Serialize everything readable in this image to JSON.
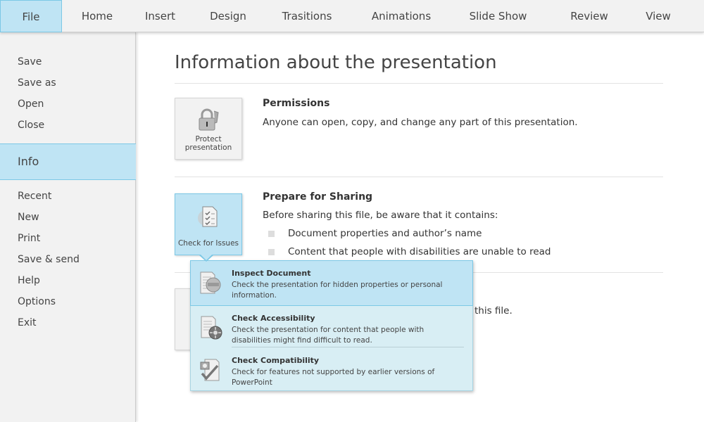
{
  "tabs": [
    "File",
    "Home",
    "Insert",
    "Design",
    "Trasitions",
    "Animations",
    "Slide Show",
    "Review",
    "View"
  ],
  "sidebar": {
    "items": [
      "Save",
      "Save as",
      "Open",
      "Close",
      "Info",
      "Recent",
      "New",
      "Print",
      "Save & send",
      "Help",
      "Options",
      "Exit"
    ],
    "active": "Info"
  },
  "main": {
    "title": "Information about the presentation",
    "permissions": {
      "button": "Protect presentation",
      "title": "Permissions",
      "desc": "Anyone can open, copy, and change any part of this presentation."
    },
    "sharing": {
      "button": "Check for Issues",
      "title": "Prepare for Sharing",
      "desc": "Before sharing this file, be aware that it contains:",
      "bullets": [
        "Document properties and author’s name",
        "Content that people with disabilities are unable to read"
      ]
    },
    "third": {
      "desc_visible": "this file."
    }
  },
  "menu": [
    {
      "title": "Inspect Document",
      "desc": "Check the presentation for hidden properties or personal information.",
      "icon": "inspect-document-icon"
    },
    {
      "title": "Check Accessibility",
      "desc": "Check the presentation for content that people with disabilities might find difficult to read.",
      "icon": "accessibility-icon"
    },
    {
      "title": "Check Compatibility",
      "desc": "Check for features not supported by earlier versions of PowerPoint",
      "icon": "compatibility-icon"
    }
  ],
  "colors": {
    "accent": "#bfe4f4",
    "accent_border": "#7cc8e6",
    "menu_bg": "#d8eef4"
  }
}
